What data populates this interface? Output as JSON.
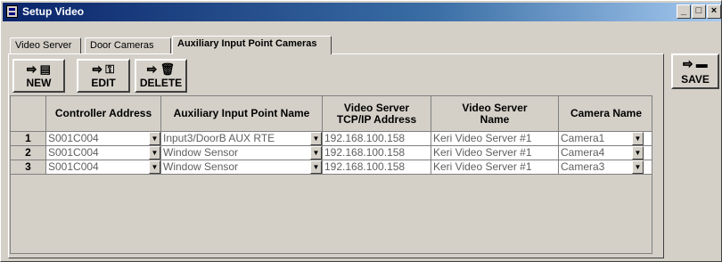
{
  "window": {
    "title": "Setup Video",
    "controls": [
      "_",
      "□",
      "×"
    ]
  },
  "tabs": [
    {
      "label": "Video Server"
    },
    {
      "label": "Door Cameras"
    },
    {
      "label": "Auxiliary Input Point Cameras"
    }
  ],
  "toolbar": {
    "new_label": "NEW",
    "edit_label": "EDIT",
    "delete_label": "DELETE",
    "save_label": "SAVE"
  },
  "table": {
    "headers": [
      "Controller Address",
      "Auxiliary Input Point Name",
      "Video Server TCP/IP Address",
      "Video Server Name",
      "Camera Name"
    ],
    "rows": [
      {
        "num": "1",
        "controller": "S001C004",
        "input": "Input3/DoorB AUX RTE",
        "ip": "192.168.100.158",
        "server": "Keri Video Server #1",
        "camera": "Camera1"
      },
      {
        "num": "2",
        "controller": "S001C004",
        "input": "Window Sensor",
        "ip": "192.168.100.158",
        "server": "Keri Video Server #1",
        "camera": "Camera4"
      },
      {
        "num": "3",
        "controller": "S001C004",
        "input": "Window Sensor",
        "ip": "192.168.100.158",
        "server": "Keri Video Server #1",
        "camera": "Camera3"
      }
    ]
  }
}
